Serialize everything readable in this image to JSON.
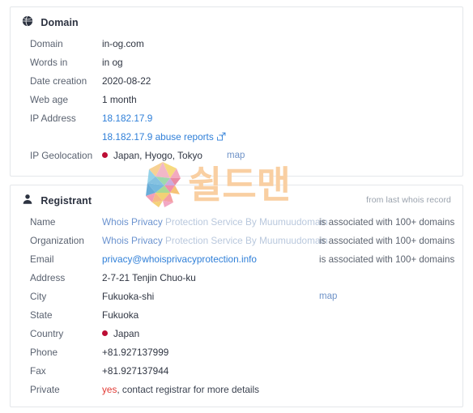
{
  "domain_card": {
    "icon": "globe-icon",
    "title": "Domain",
    "rows": [
      {
        "label": "Domain",
        "value": "in-og.com"
      },
      {
        "label": "Words in",
        "value": "in og"
      },
      {
        "label": "Date creation",
        "value": "2020-08-22"
      },
      {
        "label": "Web age",
        "value": "1 month"
      },
      {
        "label": "IP Address",
        "value": "18.182.17.9"
      },
      {
        "label": "",
        "value": "18.182.17.9 abuse reports"
      },
      {
        "label": "IP Geolocation",
        "value": "Japan, Hyogo, Tokyo",
        "map_label": "map"
      }
    ]
  },
  "registrant_card": {
    "icon": "user-icon",
    "title": "Registrant",
    "note": "from last whois record",
    "rows": [
      {
        "label": "Name",
        "value_strong": "Whois Privacy",
        "value_faded": "Protection Service By Muumuudomain",
        "assoc": "is associated with 100+ domains"
      },
      {
        "label": "Organization",
        "value_strong": "Whois Privacy",
        "value_faded": "Protection Service By Muumuudomain",
        "assoc": "is associated with 100+ domains"
      },
      {
        "label": "Email",
        "value": "privacy@whoisprivacyprotection.info",
        "assoc": "is associated with 100+ domains"
      },
      {
        "label": "Address",
        "value": "2-7-21 Tenjin Chuo-ku"
      },
      {
        "label": "City",
        "value": "Fukuoka-shi",
        "map_label": "map"
      },
      {
        "label": "State",
        "value": "Fukuoka"
      },
      {
        "label": "Country",
        "value": "Japan"
      },
      {
        "label": "Phone",
        "value": "+81.927137999"
      },
      {
        "label": "Fax",
        "value": "+81.927137944"
      },
      {
        "label": "Private",
        "value_red": "yes",
        "value_rest": ", contact registrar for more details"
      }
    ]
  },
  "watermark": {
    "logo": "shieldman-s-logo",
    "text": "쉴드맨",
    "text_color": "#f9cfa2"
  },
  "colors": {
    "link": "#2f7fd8",
    "link_soft": "#6b93cf",
    "link_faded": "#b9c8dd",
    "flag_dot": "#bc0d34",
    "alert": "#e23b35",
    "card_border": "#e4e7ea"
  }
}
